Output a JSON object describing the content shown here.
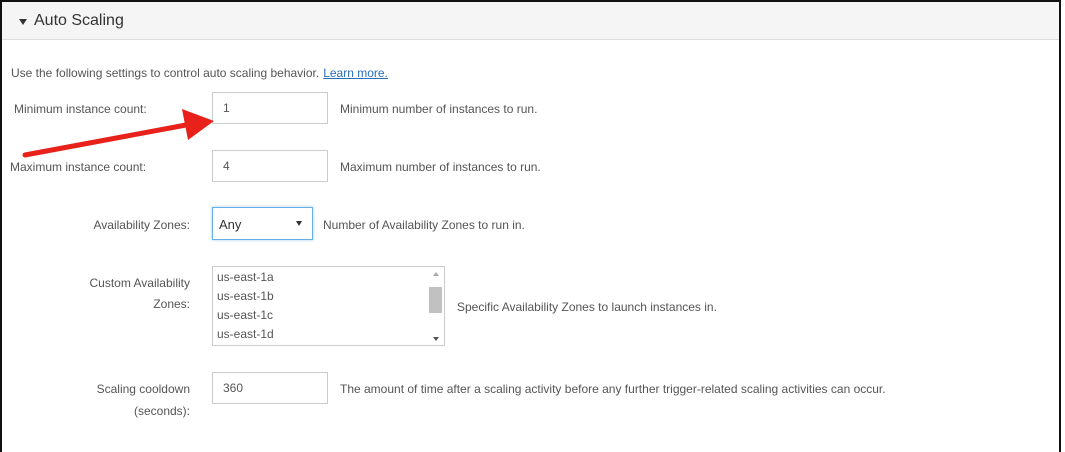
{
  "section": {
    "title": "Auto Scaling",
    "collapse_icon": "caret-down-icon"
  },
  "intro": {
    "text": "Use the following settings to control auto scaling behavior.",
    "link": "Learn more."
  },
  "fields": {
    "min": {
      "label": "Minimum instance count:",
      "value": "1",
      "help": "Minimum number of instances to run."
    },
    "max": {
      "label": "Maximum instance count:",
      "value": "4",
      "help": "Maximum number of instances to run."
    },
    "az": {
      "label": "Availability Zones:",
      "value": "Any",
      "help": "Number of Availability Zones to run in."
    },
    "custom_az": {
      "label_line1": "Custom Availability",
      "label_line2": "Zones:",
      "options": [
        "us-east-1a",
        "us-east-1b",
        "us-east-1c",
        "us-east-1d"
      ],
      "help": "Specific Availability Zones to launch instances in."
    },
    "cooldown": {
      "label_line1": "Scaling cooldown",
      "label_line2": "(seconds):",
      "value": "360",
      "help": "The amount of time after a scaling activity before any further trigger-related scaling activities can occur."
    }
  },
  "annotation": {
    "arrow_color": "#e8211b",
    "arrow_icon": "red-annotation-arrow-icon"
  }
}
